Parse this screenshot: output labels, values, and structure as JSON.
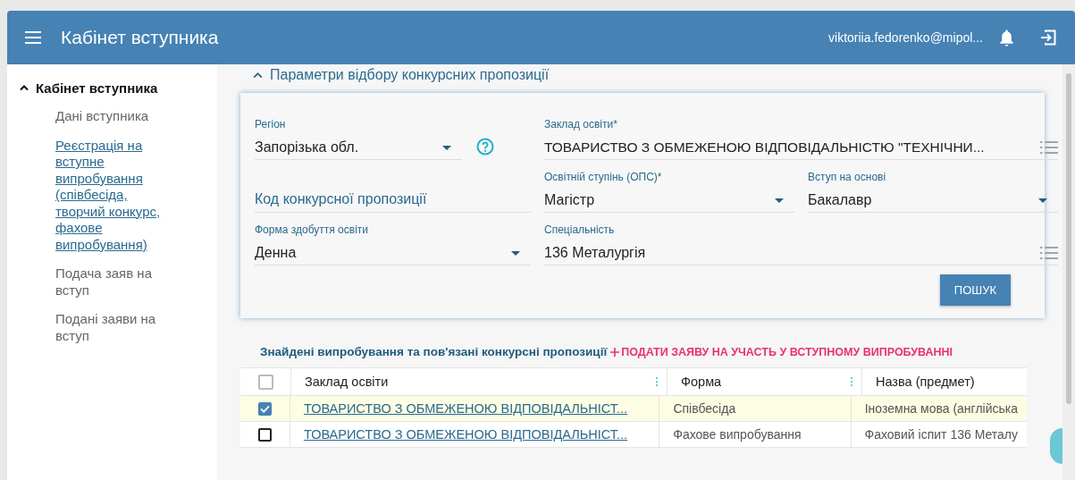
{
  "header": {
    "title": "Кабінет вступника",
    "user": "viktoriia.fedorenko@mipol..."
  },
  "sidebar": {
    "title": "Кабінет вступника",
    "expanded": true,
    "items": [
      {
        "label": "Дані вступника",
        "selected": false
      },
      {
        "label": "Реєстрація на вступне випробування (співбесіда, творчий конкурс, фахове випробування)",
        "selected": true
      },
      {
        "label": "Подача заяв на вступ",
        "selected": false
      },
      {
        "label": "Подані заяви на вступ",
        "selected": false
      }
    ]
  },
  "filters": {
    "title": "Параметри відбору конкурсних пропозиції",
    "expanded": true,
    "fields": [
      {
        "kind": "select",
        "label": "Регіон",
        "value": "Запорізька обл.",
        "help": true
      },
      {
        "kind": "list",
        "label": "Заклад освіти*",
        "value": "ТОВАРИСТВО З ОБМЕЖЕНОЮ ВІДПОВІДАЛЬНІСТЮ \"ТЕХНІЧНИ..."
      },
      {
        "kind": "text",
        "placeholder": "Код конкурсної пропозиції"
      },
      {
        "kind": "select",
        "label": "Освітній ступінь (ОПС)*",
        "value": "Магістр"
      },
      {
        "kind": "select",
        "label": "Вступ на основі",
        "value": "Бакалавр"
      },
      {
        "kind": "select",
        "label": "Форма здобуття освіти",
        "value": "Денна"
      },
      {
        "kind": "list",
        "label": "Спеціальність",
        "value": "136 Металургія"
      }
    ],
    "button": "ПОШУК"
  },
  "results": {
    "title": "Знайдені випробування та пов'язані конкурсні пропозиції",
    "action": "ПОДАТИ ЗАЯВУ НА УЧАСТЬ У ВСТУПНОМУ ВИПРОБУВАННІ",
    "all_checked": false,
    "columns": [
      "Заклад освіти",
      "Форма",
      "Назва (предмет)"
    ],
    "rows": [
      {
        "checked": true,
        "cells": [
          "ТОВАРИСТВО З ОБМЕЖЕНОЮ ВІДПОВІДАЛЬНІСТ...",
          "Співбесіда",
          "Іноземна мова (англійська"
        ]
      },
      {
        "checked": false,
        "cells": [
          "ТОВАРИСТВО З ОБМЕЖЕНОЮ ВІДПОВІДАЛЬНІСТ...",
          "Фахове випробування",
          "Фаховий іспит 136 Металу"
        ]
      }
    ]
  }
}
